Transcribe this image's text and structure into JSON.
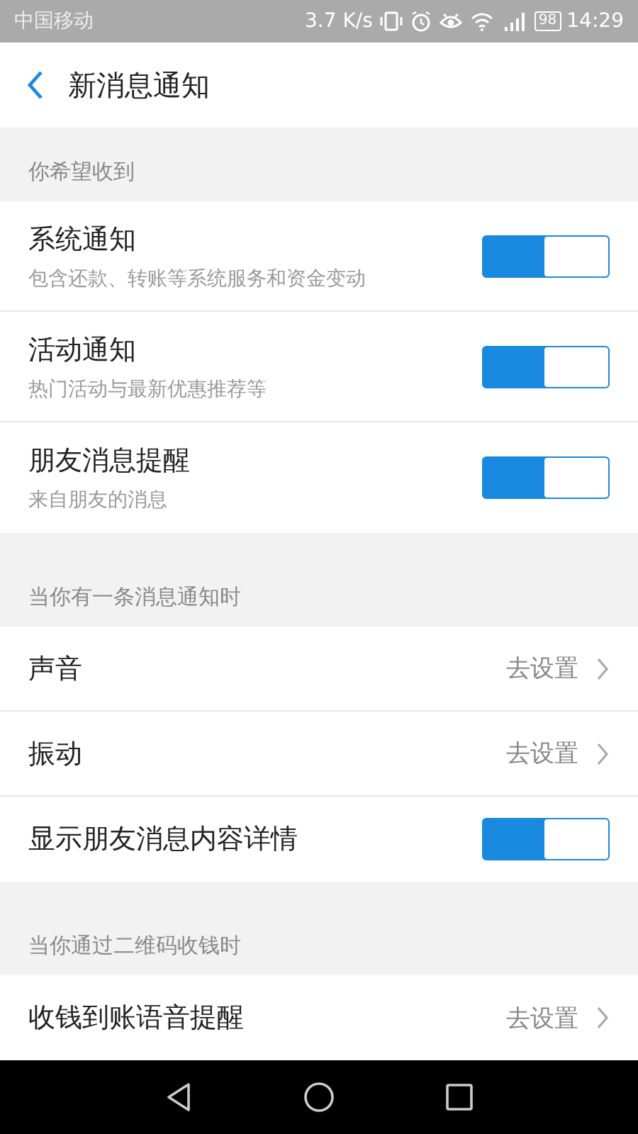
{
  "status_bar": {
    "carrier": "中国移动",
    "speed": "3.7 K/s",
    "battery": "98",
    "time": "14:29"
  },
  "header": {
    "title": "新消息通知"
  },
  "sections": [
    {
      "label": "你希望收到",
      "items": [
        {
          "kind": "toggle",
          "title": "系统通知",
          "subtitle": "包含还款、转账等系统服务和资金变动",
          "on": true
        },
        {
          "kind": "toggle",
          "title": "活动通知",
          "subtitle": "热门活动与最新优惠推荐等",
          "on": true
        },
        {
          "kind": "toggle",
          "title": "朋友消息提醒",
          "subtitle": "来自朋友的消息",
          "on": true
        }
      ]
    },
    {
      "label": "当你有一条消息通知时",
      "items": [
        {
          "kind": "link",
          "title": "声音",
          "value": "去设置"
        },
        {
          "kind": "link",
          "title": "振动",
          "value": "去设置"
        },
        {
          "kind": "toggle",
          "title": "显示朋友消息内容详情",
          "on": true
        }
      ]
    },
    {
      "label": "当你通过二维码收钱时",
      "items": [
        {
          "kind": "link",
          "title": "收钱到账语音提醒",
          "value": "去设置"
        }
      ]
    }
  ]
}
